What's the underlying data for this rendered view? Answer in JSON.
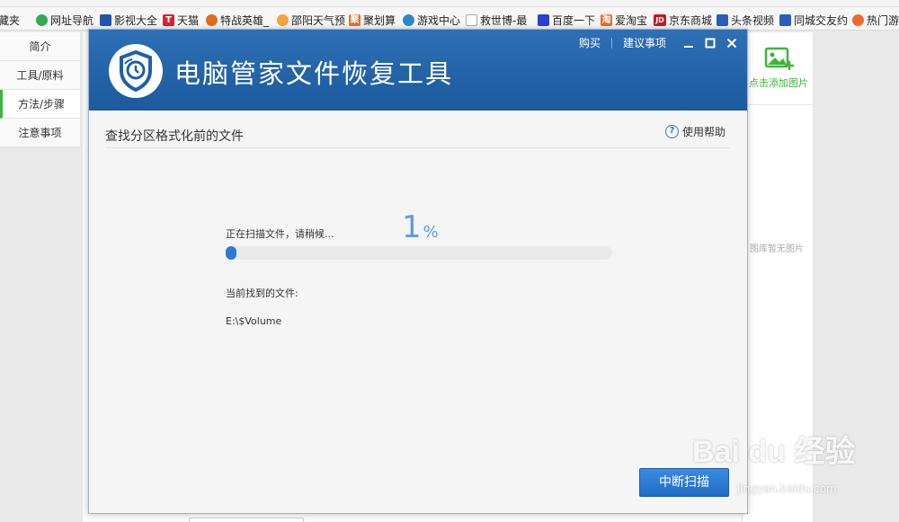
{
  "bookmarks": [
    {
      "label": "收藏夹",
      "icon": "favorites-icon",
      "color": "#f0a020"
    },
    {
      "label": "网址导航",
      "icon": "home-icon",
      "color": "#34a853"
    },
    {
      "label": "影视大全",
      "icon": "film-icon",
      "color": "#2255aa"
    },
    {
      "label": "天猫",
      "icon": "tmall-icon",
      "color": "#d9232e"
    },
    {
      "label": "特战英雄_",
      "icon": "game-character-icon",
      "color": "#e56a1c"
    },
    {
      "label": "邵阳天气预",
      "icon": "weather-icon",
      "color": "#f2a33a"
    },
    {
      "label": "聚划算",
      "icon": "juhuasuan-icon",
      "color": "#ee6a2a"
    },
    {
      "label": "游戏中心",
      "icon": "gamepad-icon",
      "color": "#2a88cc"
    },
    {
      "label": "救世博-最",
      "icon": "page-icon",
      "color": "#aaaaaa"
    },
    {
      "label": "百度一下",
      "icon": "baidu-paw-icon",
      "color": "#2b3fd0"
    },
    {
      "label": "爱淘宝",
      "icon": "taobao-icon",
      "color": "#ee6a2a"
    },
    {
      "label": "京东商城",
      "icon": "jd-icon",
      "color": "#c81623"
    },
    {
      "label": "头条视频",
      "icon": "toutiao-icon",
      "color": "#2a5bbf"
    },
    {
      "label": "同城交友约",
      "icon": "tongcheng-icon",
      "color": "#2a5bbf"
    },
    {
      "label": "热门游戏",
      "icon": "flame-icon",
      "color": "#ee6a2a"
    }
  ],
  "bookmark_icon_glyphs": {
    "tmall": "T",
    "juhuasuan": "聚",
    "taobao": "淘",
    "jd": "JD"
  },
  "leftnav": [
    {
      "label": "简介"
    },
    {
      "label": "工具/原料"
    },
    {
      "label": "方法/步骤"
    },
    {
      "label": "注意事项"
    }
  ],
  "rightpanel": {
    "add_picture": "点击添加图片",
    "no_picture": "图库暂无图片"
  },
  "dialog": {
    "title": "电脑管家文件恢复工具",
    "links": {
      "buy": "购买",
      "suggest": "建议事项"
    },
    "subtitle": "查找分区格式化前的文件",
    "help": "使用帮助",
    "help_glyph": "?",
    "scanning_label": "正在扫描文件，请稍候...",
    "percent_value": "1",
    "percent_symbol": "%",
    "progress": 0.01,
    "found_label": "当前找到的文件:",
    "found_value": "E:\\$Volume",
    "stop_button": "中断扫描"
  },
  "watermark": {
    "main": "Bai du 经验",
    "url": "jingyan.baidu.com"
  },
  "colors": {
    "header_blue": "#1c5a9e",
    "accent_blue": "#2f79d6",
    "green": "#3bb53b"
  }
}
